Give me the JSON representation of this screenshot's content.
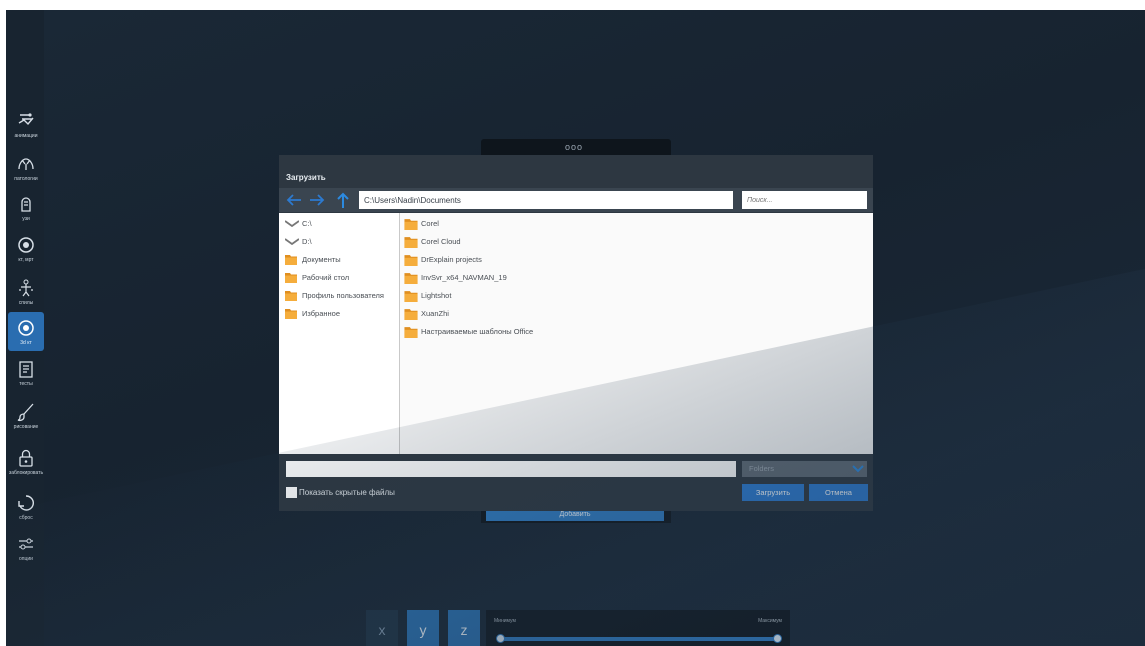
{
  "sidebar": {
    "items": [
      {
        "label": "анимации",
        "icon": "animation-icon"
      },
      {
        "label": "патологии",
        "icon": "pathology-icon"
      },
      {
        "label": "узи",
        "icon": "ultrasound-icon"
      },
      {
        "label": "кт, мрт",
        "icon": "ct-mri-icon"
      },
      {
        "label": "спилы",
        "icon": "slices-icon"
      },
      {
        "label": "3d кт",
        "icon": "3d-ct-icon",
        "active": true
      },
      {
        "label": "тесты",
        "icon": "tests-icon"
      },
      {
        "label": "рисование",
        "icon": "brush-icon"
      },
      {
        "label": "заблокировать",
        "icon": "lock-icon"
      },
      {
        "label": "сброс",
        "icon": "reset-icon"
      },
      {
        "label": "опции",
        "icon": "options-icon"
      }
    ]
  },
  "background": {
    "tab_label": "ооо",
    "add_button": "Добавить"
  },
  "dialog": {
    "title": "Загрузить",
    "path": "C:\\Users\\Nadin\\Documents",
    "search_placeholder": "Поиск...",
    "locations": [
      {
        "label": "C:\\",
        "type": "drive"
      },
      {
        "label": "D:\\",
        "type": "drive"
      },
      {
        "label": "Документы",
        "type": "folder"
      },
      {
        "label": "Рабочий стол",
        "type": "folder"
      },
      {
        "label": "Профиль пользователя",
        "type": "folder"
      },
      {
        "label": "Избранное",
        "type": "folder"
      }
    ],
    "folders": [
      "Corel",
      "Corel Cloud",
      "DrExplain projects",
      "InvSvr_x64_NAVMAN_19",
      "Lightshot",
      "XuanZhi",
      "Настраиваемые шаблоны Office"
    ],
    "file_name_value": "",
    "filter": "Folders",
    "show_hidden_label": "Показать скрытые файлы",
    "upload_button": "Загрузить",
    "cancel_button": "Отмена"
  },
  "controls": {
    "axes": [
      "x",
      "y",
      "z"
    ],
    "slider_min_label": "Минимум",
    "slider_max_label": "Максимум",
    "range": [
      0,
      1
    ]
  },
  "colors": {
    "accent": "#2c7ad0",
    "folder": "#f0a030",
    "dialog_bg": "#2d3741"
  }
}
